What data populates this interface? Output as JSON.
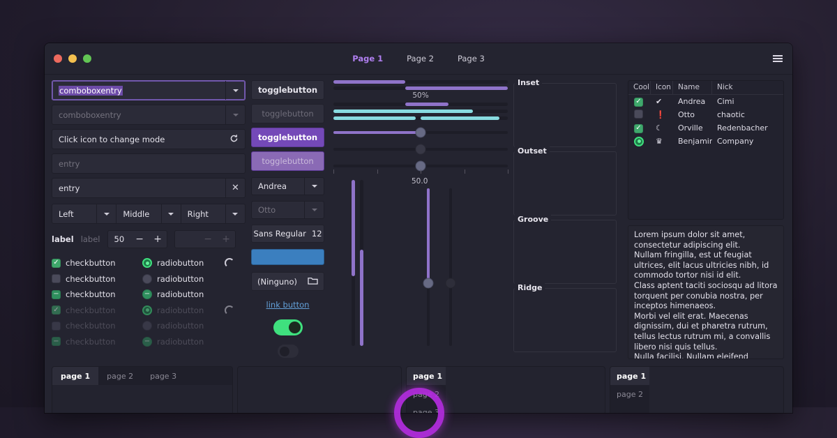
{
  "window": {
    "controls": {
      "close": "close",
      "minimize": "minimize",
      "maximize": "maximize"
    },
    "header": {
      "tabs": [
        {
          "label": "Page 1",
          "active": true
        },
        {
          "label": "Page 2",
          "active": false
        },
        {
          "label": "Page 3",
          "active": false
        }
      ],
      "menu_icon": "hamburger-menu-icon"
    }
  },
  "left": {
    "comboboxentry_focused": {
      "value": "comboboxentry",
      "selected": true
    },
    "comboboxentry_dim": {
      "value": "comboboxentry"
    },
    "entry_icon_mode": {
      "value": "Click icon to change mode",
      "icon": "refresh-icon"
    },
    "entry_placeholder": {
      "placeholder": "entry",
      "value": ""
    },
    "entry_clear": {
      "value": "entry",
      "icon": "clear-icon"
    },
    "combos": [
      {
        "label": "Left"
      },
      {
        "label": "Middle"
      },
      {
        "label": "Right"
      }
    ],
    "labels": [
      "label",
      "label"
    ],
    "spinbutton": {
      "value": "50",
      "minus": "−",
      "plus": "+"
    },
    "spinbutton_disabled": {
      "value": "",
      "minus": "−",
      "plus": "+"
    },
    "checks": [
      {
        "label": "checkbutton",
        "state": "checked",
        "enabled": true
      },
      {
        "label": "checkbutton",
        "state": "unchecked",
        "enabled": true
      },
      {
        "label": "checkbutton",
        "state": "mixed",
        "enabled": true
      },
      {
        "label": "checkbutton",
        "state": "checked",
        "enabled": false
      },
      {
        "label": "checkbutton",
        "state": "unchecked",
        "enabled": false
      },
      {
        "label": "checkbutton",
        "state": "mixed",
        "enabled": false
      }
    ],
    "radios": [
      {
        "label": "radiobutton",
        "state": "checked",
        "enabled": true
      },
      {
        "label": "radiobutton",
        "state": "unchecked",
        "enabled": true
      },
      {
        "label": "radiobutton",
        "state": "mixed",
        "enabled": true
      },
      {
        "label": "radiobutton",
        "state": "checked",
        "enabled": false
      },
      {
        "label": "radiobutton",
        "state": "unchecked",
        "enabled": false
      },
      {
        "label": "radiobutton",
        "state": "mixed",
        "enabled": false
      }
    ],
    "spinners": [
      "spinner-icon",
      "spinner-icon"
    ]
  },
  "middle": {
    "togglebuttons": [
      {
        "label": "togglebutton",
        "style": "normal"
      },
      {
        "label": "togglebutton",
        "style": "disabled"
      },
      {
        "label": "togglebutton",
        "style": "active"
      },
      {
        "label": "togglebutton",
        "style": "active-disabled"
      }
    ],
    "combo_andrea": {
      "label": "Andrea"
    },
    "combo_otto": {
      "label": "Otto"
    },
    "font_button": {
      "family": "Sans Regular",
      "size": "12"
    },
    "color_button": {
      "color": "#3b7fbf"
    },
    "file_button": {
      "label": "(Ninguno)",
      "icon": "folder-icon"
    },
    "link_button": {
      "label": "link button"
    },
    "switch_on": {
      "state": "on"
    },
    "switch_off": {
      "state": "off"
    }
  },
  "sliders": {
    "progress_label": "50%",
    "scale_value_label": "50.0",
    "progressbars": [
      {
        "name": "progress-top",
        "fraction": 0.41,
        "color": "#8f73c9",
        "inverted": false
      },
      {
        "name": "progress-inverted",
        "fraction": 0.59,
        "color": "#8f73c9",
        "inverted": true
      },
      {
        "name": "progress-pulse",
        "fraction": 0.25,
        "offset": 0.41,
        "color": "#8f73c9"
      },
      {
        "name": "progress-teal",
        "fraction": 0.8,
        "color": "#88dbe0"
      },
      {
        "name": "progress-teal-split",
        "fraction": 0.495,
        "color": "#88dbe0"
      }
    ],
    "scales": [
      {
        "name": "scale-horizontal",
        "value": 50,
        "fill": true
      },
      {
        "name": "scale-horizontal-disabled",
        "value": 50,
        "fill": false
      },
      {
        "name": "scale-with-marks",
        "value": 50,
        "fill": false
      }
    ],
    "marks": [
      0,
      25,
      50,
      75,
      100
    ],
    "vertical": [
      {
        "name": "vprogress-a",
        "fraction": 0.58,
        "inverted": true
      },
      {
        "name": "vprogress-b",
        "fraction": 0.58,
        "inverted": false
      },
      {
        "name": "vscale-a",
        "value": 60
      },
      {
        "name": "vscale-b",
        "value": 60
      }
    ]
  },
  "frames": [
    {
      "title": "Inset"
    },
    {
      "title": "Outset"
    },
    {
      "title": "Groove"
    },
    {
      "title": "Ridge"
    }
  ],
  "treeview": {
    "columns": [
      "Cool",
      "Icon",
      "Name",
      "Nick"
    ],
    "rows": [
      {
        "cool": "checked",
        "icon": "✔",
        "icon_name": "check-circle-icon",
        "name": "Andrea",
        "nick": "Cimi"
      },
      {
        "cool": "unchecked",
        "icon": "❗",
        "icon_name": "warning-icon",
        "name": "Otto",
        "nick": "chaotic"
      },
      {
        "cool": "checked",
        "icon": "☾",
        "icon_name": "moon-icon",
        "name": "Orville",
        "nick": "Redenbacher"
      },
      {
        "cool": "radio",
        "icon": "♛",
        "icon_name": "crown-icon",
        "name": "Benjamin",
        "nick": "Company"
      }
    ]
  },
  "textview": {
    "paragraphs": [
      "Lorem ipsum dolor sit amet, consectetur adipiscing elit.",
      "Nullam fringilla, est ut feugiat ultrices, elit lacus ultricies nibh, id commodo tortor nisi id elit.",
      "Class aptent taciti sociosqu ad litora torquent per conubia nostra, per inceptos himenaeos.",
      "Morbi vel elit erat. Maecenas dignissim, dui et pharetra rutrum, tellus lectus rutrum mi, a convallis libero nisi quis tellus.",
      "Nulla facilisi. Nullam eleifend lobortis nisl, in porttitor tellus malesuada vitae."
    ]
  },
  "notebooks": {
    "top_tabs": {
      "tabs": [
        "page 1",
        "page 2",
        "page 3"
      ],
      "active": 0
    },
    "bottom_tabs": {
      "tabs": [
        "page 1",
        "page 2",
        "page 3"
      ],
      "active": 0
    },
    "right_tabs": {
      "tabs": [
        "page 1",
        "page 2"
      ],
      "active": 0
    }
  },
  "colors": {
    "accent_purple": "#7449b8",
    "accent_purple_light": "#8f73c9",
    "accent_teal": "#88dbe0",
    "accent_green": "#3fe07e",
    "accent_blue": "#3b7fbf",
    "link": "#63a0d8",
    "header_active": "#b07ff0",
    "cursor_ring": "#b42de0"
  }
}
